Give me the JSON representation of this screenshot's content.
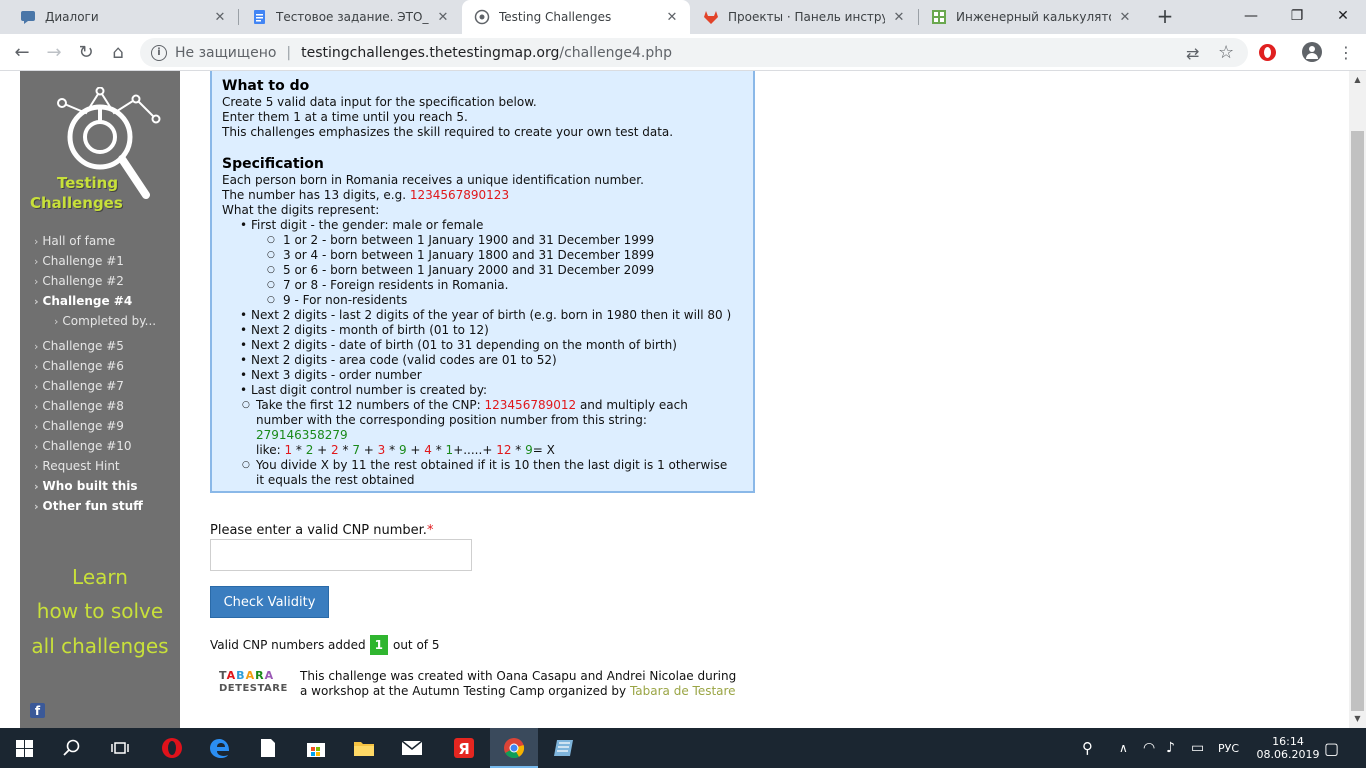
{
  "browser": {
    "tabs": [
      {
        "title": "Диалоги",
        "icon": "vk-chat-icon"
      },
      {
        "title": "Тестовое задание. ЭТО_Инкуб",
        "icon": "docs-icon"
      },
      {
        "title": "Testing Challenges",
        "icon": "globe-icon",
        "active": true
      },
      {
        "title": "Проекты · Панель инструмент",
        "icon": "gitlab-icon"
      },
      {
        "title": "Инженерный калькулятор он",
        "icon": "calculator-icon"
      }
    ],
    "new_tab": "+",
    "address": {
      "security_label": "Не защищено",
      "host": "testingchallenges.thetestingmap.org",
      "path": "/challenge4.php"
    }
  },
  "sidebar": {
    "logo_line1": "Testing",
    "logo_line2": "Challenges",
    "items": [
      {
        "label": "Hall of fame",
        "bold": false
      },
      {
        "label": "Challenge #1",
        "bold": false
      },
      {
        "label": "Challenge #2",
        "bold": false
      },
      {
        "label": "Challenge #4",
        "bold": true
      },
      {
        "label": "Completed by...",
        "bold": false,
        "sub": true
      },
      {
        "label": "Challenge #5",
        "bold": false
      },
      {
        "label": "Challenge #6",
        "bold": false
      },
      {
        "label": "Challenge #7",
        "bold": false
      },
      {
        "label": "Challenge #8",
        "bold": false
      },
      {
        "label": "Challenge #9",
        "bold": false
      },
      {
        "label": "Challenge #10",
        "bold": false
      },
      {
        "label": "Request Hint",
        "bold": false
      },
      {
        "label": "Who built this",
        "bold": true
      },
      {
        "label": "Other fun stuff",
        "bold": true
      }
    ],
    "learn": [
      "Learn",
      "how to solve",
      "all challenges"
    ]
  },
  "challenge": {
    "what_title": "What to do",
    "what_lines": [
      "Create 5 valid data input for the specification below.",
      "Enter them 1 at a time until you reach 5.",
      "This challenges emphasizes the skill required to create your own test data."
    ],
    "spec_title": "Specification",
    "spec_line1": "Each person born in Romania receives a unique identification number.",
    "spec_line2_prefix": "The number has 13 digits, e.g. ",
    "spec_example": "1234567890123",
    "spec_line3": "What the digits represent:",
    "first_digit": "First digit - the gender: male or female",
    "gender_rules": [
      "1 or 2 - born between 1 January 1900 and 31 December 1999",
      "3 or 4 - born between 1 January 1800 and 31 December 1899",
      "5 or 6 - born between 1 January 2000 and 31 December 2099",
      "7 or 8 - Foreign residents in Romania.",
      "9 - For non-residents"
    ],
    "next_rules": [
      "Next 2 digits - last 2 digits of the year of birth (e.g. born in 1980 then it will 80 )",
      "Next 2 digits - month of birth (01 to 12)",
      "Next 2 digits - date of birth (01 to 31 depending on the month of birth)",
      "Next 2 digits - area code (valid codes are 01 to 52)",
      "Next 3 digits - order number",
      "Last digit control number is created by:"
    ],
    "control_1a": "Take the first 12 numbers of the CNP: ",
    "control_1_cnp": "123456789012",
    "control_1b": " and multiply each number with the corresponding position number from this string: ",
    "control_1_key": "279146358279",
    "control_like": "like: ",
    "control_formula": [
      {
        "t": "1",
        "c": "red"
      },
      {
        "t": " * ",
        "c": ""
      },
      {
        "t": "2",
        "c": "green"
      },
      {
        "t": " + ",
        "c": ""
      },
      {
        "t": "2",
        "c": "red"
      },
      {
        "t": " * ",
        "c": ""
      },
      {
        "t": "7",
        "c": "green"
      },
      {
        "t": " + ",
        "c": ""
      },
      {
        "t": "3",
        "c": "red"
      },
      {
        "t": " * ",
        "c": ""
      },
      {
        "t": "9",
        "c": "green"
      },
      {
        "t": " + ",
        "c": ""
      },
      {
        "t": "4",
        "c": "red"
      },
      {
        "t": " * ",
        "c": ""
      },
      {
        "t": "1",
        "c": "green"
      },
      {
        "t": "+.....+ ",
        "c": ""
      },
      {
        "t": "12",
        "c": "red"
      },
      {
        "t": " * ",
        "c": ""
      },
      {
        "t": "9",
        "c": "green"
      },
      {
        "t": "= X",
        "c": ""
      }
    ],
    "control_2": "You divide X by 11 the rest obtained if it is 10 then the last digit is 1 otherwise it equals the rest obtained"
  },
  "form": {
    "label": "Please enter a valid CNP number.",
    "required_mark": "*",
    "input_value": "",
    "button_label": "Check Validity"
  },
  "progress": {
    "prefix": "Valid CNP numbers added",
    "count": "1",
    "suffix": "out of 5"
  },
  "credit": {
    "logo_line1": "TABARA",
    "logo_line2": "DETESTARE",
    "text": "This challenge was created with Oana Casapu and Andrei Nicolae during a workshop at the Autumn Testing Camp organized by ",
    "link": "Tabara de Testare"
  },
  "taskbar": {
    "lang": "РУС",
    "time": "16:14",
    "date": "08.06.2019"
  },
  "colors": {
    "sidebar_bg": "#707070",
    "accent_green": "#c8e03a",
    "button_blue": "#3a7dbf",
    "box_bg": "#ddeeff",
    "badge_green": "#2fb52f"
  }
}
